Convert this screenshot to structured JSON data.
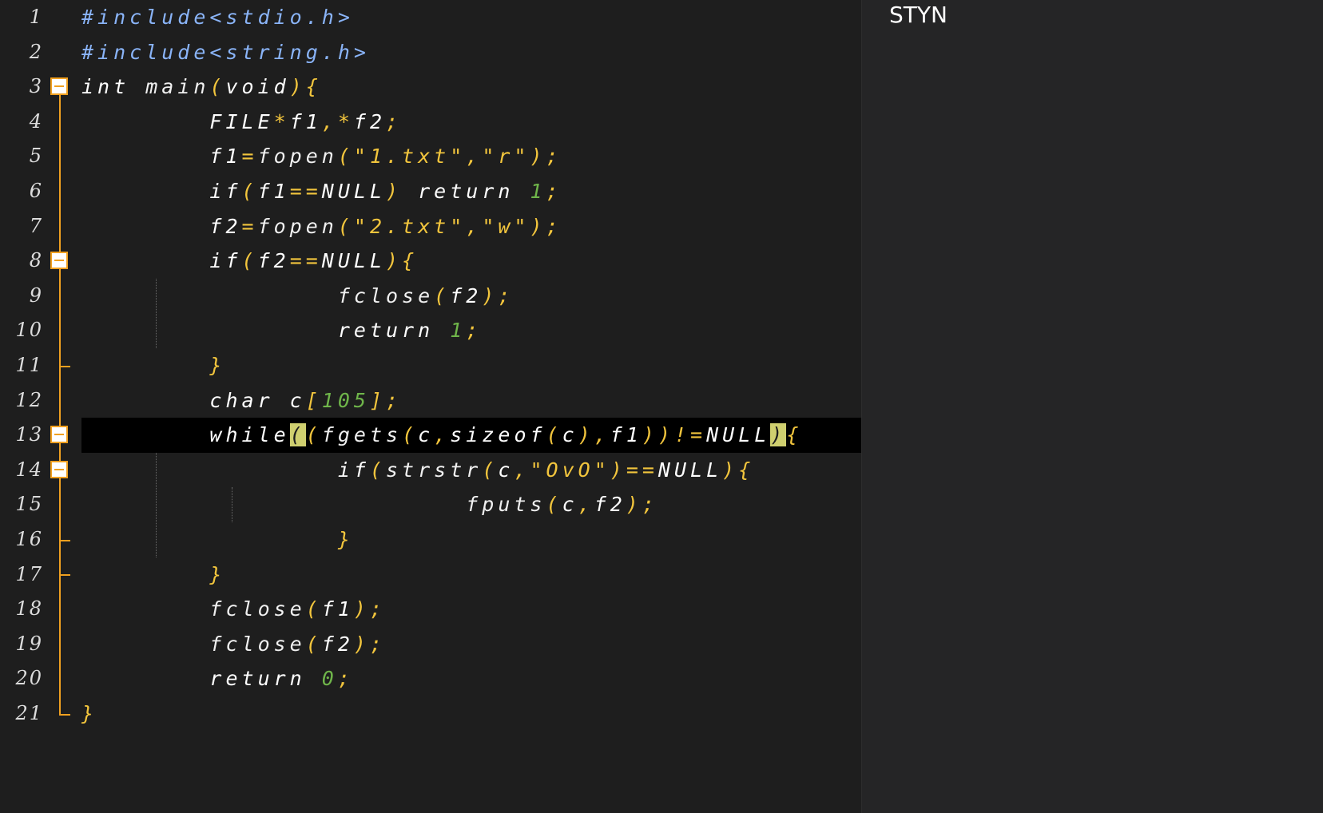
{
  "panel": {
    "title": "STYN"
  },
  "editor": {
    "current_line": 13,
    "lines": [
      {
        "n": "1",
        "segments": [
          {
            "t": "#include<stdio.h>",
            "c": "pre"
          }
        ]
      },
      {
        "n": "2",
        "segments": [
          {
            "t": "#include<string.h>",
            "c": "pre"
          }
        ]
      },
      {
        "n": "3",
        "segments": [
          {
            "t": "int ",
            "c": "kw"
          },
          {
            "t": "main",
            "c": "fn"
          },
          {
            "t": "(",
            "c": "pun"
          },
          {
            "t": "void",
            "c": "kw"
          },
          {
            "t": "){",
            "c": "pun"
          }
        ]
      },
      {
        "n": "4",
        "segments": [
          {
            "t": "        FILE",
            "c": "id"
          },
          {
            "t": "*",
            "c": "pun"
          },
          {
            "t": "f1",
            "c": "id"
          },
          {
            "t": ",*",
            "c": "pun"
          },
          {
            "t": "f2",
            "c": "id"
          },
          {
            "t": ";",
            "c": "pun"
          }
        ]
      },
      {
        "n": "5",
        "segments": [
          {
            "t": "        f1",
            "c": "id"
          },
          {
            "t": "=",
            "c": "pun"
          },
          {
            "t": "fopen",
            "c": "fn"
          },
          {
            "t": "(",
            "c": "pun"
          },
          {
            "t": "\"1.txt\"",
            "c": "str"
          },
          {
            "t": ",",
            "c": "pun"
          },
          {
            "t": "\"r\"",
            "c": "str"
          },
          {
            "t": ");",
            "c": "pun"
          }
        ]
      },
      {
        "n": "6",
        "segments": [
          {
            "t": "        if",
            "c": "kw"
          },
          {
            "t": "(",
            "c": "pun"
          },
          {
            "t": "f1",
            "c": "id"
          },
          {
            "t": "==",
            "c": "pun"
          },
          {
            "t": "NULL",
            "c": "id"
          },
          {
            "t": ") ",
            "c": "pun"
          },
          {
            "t": "return ",
            "c": "kw"
          },
          {
            "t": "1",
            "c": "num"
          },
          {
            "t": ";",
            "c": "pun"
          }
        ]
      },
      {
        "n": "7",
        "segments": [
          {
            "t": "        f2",
            "c": "id"
          },
          {
            "t": "=",
            "c": "pun"
          },
          {
            "t": "fopen",
            "c": "fn"
          },
          {
            "t": "(",
            "c": "pun"
          },
          {
            "t": "\"2.txt\"",
            "c": "str"
          },
          {
            "t": ",",
            "c": "pun"
          },
          {
            "t": "\"w\"",
            "c": "str"
          },
          {
            "t": ");",
            "c": "pun"
          }
        ]
      },
      {
        "n": "8",
        "segments": [
          {
            "t": "        if",
            "c": "kw"
          },
          {
            "t": "(",
            "c": "pun"
          },
          {
            "t": "f2",
            "c": "id"
          },
          {
            "t": "==",
            "c": "pun"
          },
          {
            "t": "NULL",
            "c": "id"
          },
          {
            "t": "){",
            "c": "pun"
          }
        ]
      },
      {
        "n": "9",
        "segments": [
          {
            "t": "                fclose",
            "c": "fn"
          },
          {
            "t": "(",
            "c": "pun"
          },
          {
            "t": "f2",
            "c": "id"
          },
          {
            "t": ");",
            "c": "pun"
          }
        ]
      },
      {
        "n": "10",
        "segments": [
          {
            "t": "                return ",
            "c": "kw"
          },
          {
            "t": "1",
            "c": "num"
          },
          {
            "t": ";",
            "c": "pun"
          }
        ]
      },
      {
        "n": "11",
        "segments": [
          {
            "t": "        }",
            "c": "pun"
          }
        ]
      },
      {
        "n": "12",
        "segments": [
          {
            "t": "        char ",
            "c": "kw"
          },
          {
            "t": "c",
            "c": "id"
          },
          {
            "t": "[",
            "c": "pun"
          },
          {
            "t": "105",
            "c": "num"
          },
          {
            "t": "];",
            "c": "pun"
          }
        ]
      },
      {
        "n": "13",
        "segments": [
          {
            "t": "        while",
            "c": "kw"
          },
          {
            "t": "(",
            "c": "br"
          },
          {
            "t": "(",
            "c": "pun"
          },
          {
            "t": "fgets",
            "c": "fn"
          },
          {
            "t": "(",
            "c": "pun"
          },
          {
            "t": "c",
            "c": "id"
          },
          {
            "t": ",",
            "c": "pun"
          },
          {
            "t": "sizeof",
            "c": "kw"
          },
          {
            "t": "(",
            "c": "pun"
          },
          {
            "t": "c",
            "c": "id"
          },
          {
            "t": "),",
            "c": "pun"
          },
          {
            "t": "f1",
            "c": "id"
          },
          {
            "t": "))!=",
            "c": "pun"
          },
          {
            "t": "NULL",
            "c": "id"
          },
          {
            "t": ")",
            "c": "br"
          },
          {
            "t": "{",
            "c": "pun"
          }
        ]
      },
      {
        "n": "14",
        "segments": [
          {
            "t": "                if",
            "c": "kw"
          },
          {
            "t": "(",
            "c": "pun"
          },
          {
            "t": "strstr",
            "c": "fn"
          },
          {
            "t": "(",
            "c": "pun"
          },
          {
            "t": "c",
            "c": "id"
          },
          {
            "t": ",",
            "c": "pun"
          },
          {
            "t": "\"OvO\"",
            "c": "str"
          },
          {
            "t": ")==",
            "c": "pun"
          },
          {
            "t": "NULL",
            "c": "id"
          },
          {
            "t": "){",
            "c": "pun"
          }
        ]
      },
      {
        "n": "15",
        "segments": [
          {
            "t": "                        fputs",
            "c": "fn"
          },
          {
            "t": "(",
            "c": "pun"
          },
          {
            "t": "c",
            "c": "id"
          },
          {
            "t": ",",
            "c": "pun"
          },
          {
            "t": "f2",
            "c": "id"
          },
          {
            "t": ");",
            "c": "pun"
          }
        ]
      },
      {
        "n": "16",
        "segments": [
          {
            "t": "                }",
            "c": "pun"
          }
        ]
      },
      {
        "n": "17",
        "segments": [
          {
            "t": "        }",
            "c": "pun"
          }
        ]
      },
      {
        "n": "18",
        "segments": [
          {
            "t": "        fclose",
            "c": "fn"
          },
          {
            "t": "(",
            "c": "pun"
          },
          {
            "t": "f1",
            "c": "id"
          },
          {
            "t": ");",
            "c": "pun"
          }
        ]
      },
      {
        "n": "19",
        "segments": [
          {
            "t": "        fclose",
            "c": "fn"
          },
          {
            "t": "(",
            "c": "pun"
          },
          {
            "t": "f2",
            "c": "id"
          },
          {
            "t": ");",
            "c": "pun"
          }
        ]
      },
      {
        "n": "20",
        "segments": [
          {
            "t": "        return ",
            "c": "kw"
          },
          {
            "t": "0",
            "c": "num"
          },
          {
            "t": ";",
            "c": "pun"
          }
        ]
      },
      {
        "n": "21",
        "segments": [
          {
            "t": "}",
            "c": "pun"
          }
        ]
      }
    ],
    "fold_markers": [
      3,
      8,
      13,
      14
    ],
    "fold_ends": [
      11,
      16,
      17,
      21
    ]
  }
}
